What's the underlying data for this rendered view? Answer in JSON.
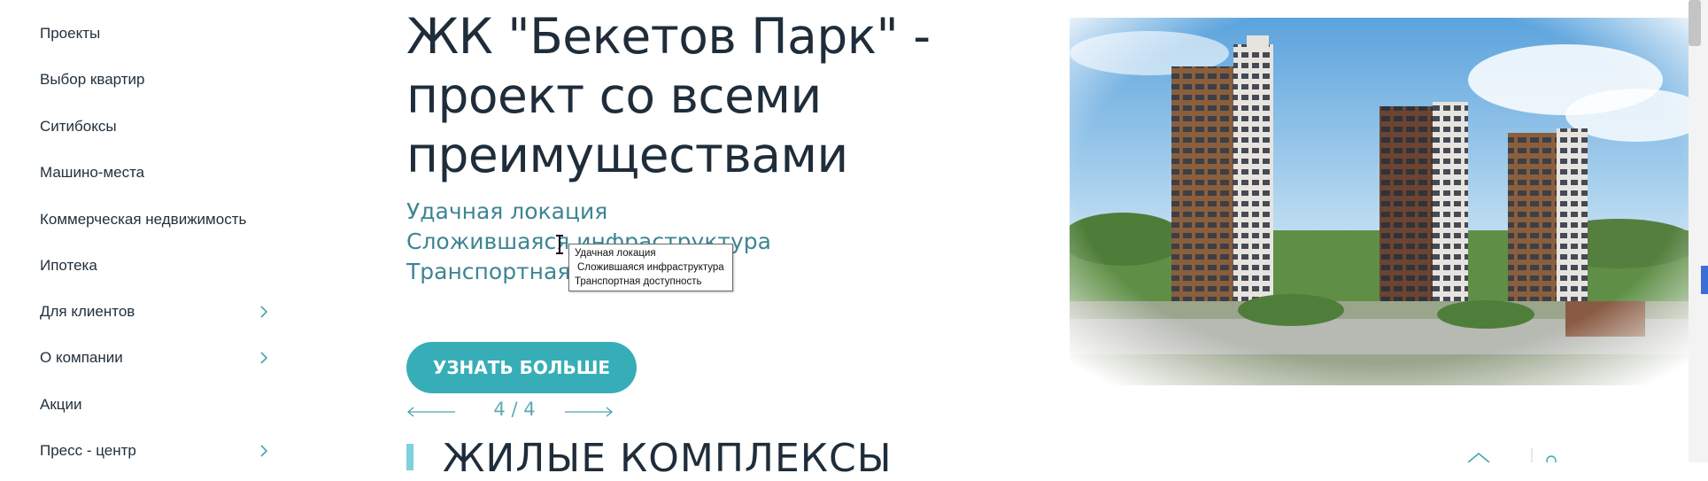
{
  "sidebar": {
    "items": [
      {
        "label": "Проекты",
        "has_submenu": false
      },
      {
        "label": "Выбор квартир",
        "has_submenu": false
      },
      {
        "label": "Ситибоксы",
        "has_submenu": false
      },
      {
        "label": "Машино-места",
        "has_submenu": false
      },
      {
        "label": "Коммерческая недвижимость",
        "has_submenu": false
      },
      {
        "label": "Ипотека",
        "has_submenu": false
      },
      {
        "label": "Для клиентов",
        "has_submenu": true
      },
      {
        "label": "О компании",
        "has_submenu": true
      },
      {
        "label": "Акции",
        "has_submenu": false
      },
      {
        "label": "Пресс - центр",
        "has_submenu": true
      }
    ]
  },
  "hero": {
    "title_lines": [
      "ЖК \"Бекетов Парк\" -",
      "проект со всеми",
      "преимуществами"
    ],
    "features": [
      "Удачная локация",
      "Сложившаяся инфраструктура",
      "Транспортная доступность"
    ],
    "cta_label": "УЗНАТЬ БОЛЬШЕ",
    "tooltip_lines": [
      "Удачная локация",
      "Сложившаяся инфраструктура",
      "Транспортная доступность"
    ]
  },
  "slider": {
    "counter": "4 / 4",
    "prev_icon": "arrow-left-icon",
    "next_icon": "arrow-right-icon"
  },
  "section": {
    "heading": "ЖИЛЫЕ КОМПЛЕКСЫ"
  },
  "colors": {
    "accent": "#37aeb7",
    "text_dark": "#1f2d3a",
    "feature_teal": "#3d8593",
    "heading_bar": "#7fd1dc"
  }
}
